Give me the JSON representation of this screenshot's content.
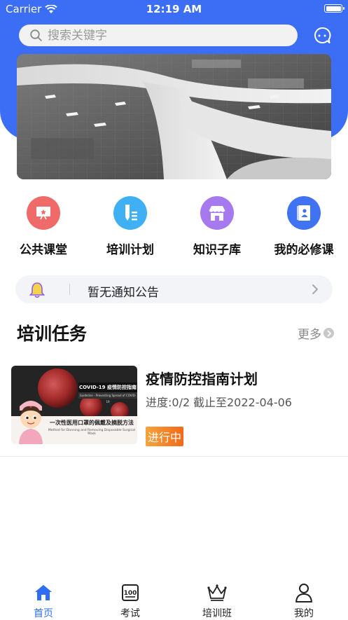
{
  "status_bar": {
    "carrier": "Carrier",
    "time": "12:19 AM",
    "battery_level": 1.0
  },
  "search": {
    "placeholder": "搜索关键字",
    "value": ""
  },
  "banner": {
    "alt": ""
  },
  "quick_entries": [
    {
      "label": "公共课堂",
      "icon": "presentation-board-icon",
      "color": "#f06a6a"
    },
    {
      "label": "培训计划",
      "icon": "pencil-list-icon",
      "color": "#3fb0f4"
    },
    {
      "label": "知识子库",
      "icon": "store-icon",
      "color": "#a679ee"
    },
    {
      "label": "我的必修课",
      "icon": "book-person-icon",
      "color": "#3f73f3"
    }
  ],
  "notice": {
    "text": "暂无通知公告"
  },
  "training_section": {
    "title": "培训任务",
    "more_label": "更多",
    "tasks": [
      {
        "title": "疫情防控指南计划",
        "progress": "进度:0/2",
        "deadline": "截止至2022-04-06",
        "status": "进行中",
        "thumb": {
          "tag_cn": "COVID-19 疫情防控指南",
          "tag_en": "Guideline - Preventing Spread of COVID-19",
          "subtitle_cn": "一次性医用口罩的佩戴及摘脱方法",
          "subtitle_en": "Method for Donning and Removing Disposable Surgical Mask"
        }
      }
    ]
  },
  "tabbar": {
    "active_color": "#2f6ef2",
    "items": [
      {
        "label": "首页",
        "icon": "home-icon",
        "active": true
      },
      {
        "label": "考试",
        "icon": "exam-100-icon",
        "active": false
      },
      {
        "label": "培训班",
        "icon": "crown-icon",
        "active": false
      },
      {
        "label": "我的",
        "icon": "person-icon",
        "active": false
      }
    ]
  },
  "colors": {
    "header": "#3b6df5",
    "badge": "#f3872a"
  }
}
